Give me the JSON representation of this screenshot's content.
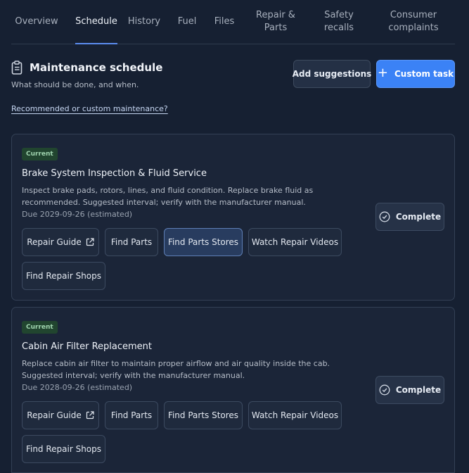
{
  "tabs": [
    {
      "label": "Overview"
    },
    {
      "label": "Schedule"
    },
    {
      "label": "History"
    },
    {
      "label": "Fuel"
    },
    {
      "label": "Files"
    },
    {
      "label": "Repair &\nParts"
    },
    {
      "label": "Safety\nrecalls"
    },
    {
      "label": "Consumer\ncomplaints"
    }
  ],
  "header": {
    "title": "Maintenance schedule",
    "subtitle": "What should be done, and when.",
    "help_link": "Recommended or custom maintenance?",
    "add_suggestions": "Add suggestions",
    "custom_task": "Custom task",
    "title_icon": "clipboard-icon"
  },
  "tasks": [
    {
      "badge": "Current",
      "title": "Brake System Inspection & Fluid Service",
      "description": "Inspect brake pads, rotors, lines, and fluid condition. Replace brake fluid as recommended. Suggested interval; verify with the manufacturer manual.",
      "due": "Due 2029-09-26 (estimated)",
      "complete": "Complete",
      "actions": {
        "repair_guide": "Repair Guide",
        "find_parts": "Find Parts",
        "find_parts_stores": "Find Parts Stores",
        "watch_videos": "Watch Repair Videos",
        "find_shops": "Find Repair Shops"
      }
    },
    {
      "badge": "Current",
      "title": "Cabin Air Filter Replacement",
      "description": "Replace cabin air filter to maintain proper airflow and air quality inside the cab. Suggested interval; verify with the manufacturer manual.",
      "due": "Due 2028-09-26 (estimated)",
      "complete": "Complete",
      "actions": {
        "repair_guide": "Repair Guide",
        "find_parts": "Find Parts",
        "find_parts_stores": "Find Parts Stores",
        "watch_videos": "Watch Repair Videos",
        "find_shops": "Find Repair Shops"
      }
    }
  ],
  "colors": {
    "background": "#162032",
    "card": "#1b2538",
    "accent": "#3b82f6",
    "badge_bg": "#21452f",
    "badge_text": "#9fd3ae"
  }
}
